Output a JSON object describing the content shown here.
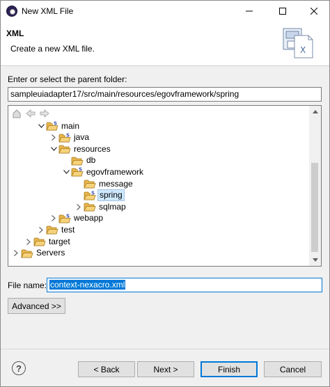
{
  "window": {
    "title": "New XML File"
  },
  "banner": {
    "title": "XML",
    "description": "Create a new XML file."
  },
  "parent_folder": {
    "label": "Enter or select the parent folder:",
    "value": "sampleuiadapter17/src/main/resources/egovframework/spring"
  },
  "tree": {
    "rows": [
      {
        "label": "main",
        "toggle": "expanded",
        "icon": "src-folder-icon"
      },
      {
        "label": "java",
        "toggle": "collapsed",
        "icon": "src-folder-icon"
      },
      {
        "label": "resources",
        "toggle": "expanded",
        "icon": "folder-icon"
      },
      {
        "label": "db",
        "toggle": "none",
        "icon": "folder-icon"
      },
      {
        "label": "egovframework",
        "toggle": "expanded",
        "icon": "src-folder-icon"
      },
      {
        "label": "message",
        "toggle": "none",
        "icon": "folder-icon"
      },
      {
        "label": "spring",
        "toggle": "none",
        "icon": "src-folder-icon",
        "selected": true
      },
      {
        "label": "sqlmap",
        "toggle": "collapsed",
        "icon": "folder-icon"
      },
      {
        "label": "webapp",
        "toggle": "collapsed",
        "icon": "src-folder-icon"
      },
      {
        "label": "test",
        "toggle": "collapsed",
        "icon": "folder-icon"
      },
      {
        "label": "target",
        "toggle": "collapsed",
        "icon": "folder-icon"
      },
      {
        "label": "Servers",
        "toggle": "collapsed",
        "icon": "folder-icon"
      }
    ]
  },
  "file_name": {
    "label": "File name:",
    "value": "context-nexacro.xml"
  },
  "buttons": {
    "advanced": "Advanced >>",
    "back": "< Back",
    "next": "Next >",
    "finish": "Finish",
    "cancel": "Cancel"
  },
  "colors": {
    "accent": "#0078d7",
    "selection": "#cde8ff",
    "folder": "#e8b64c"
  }
}
